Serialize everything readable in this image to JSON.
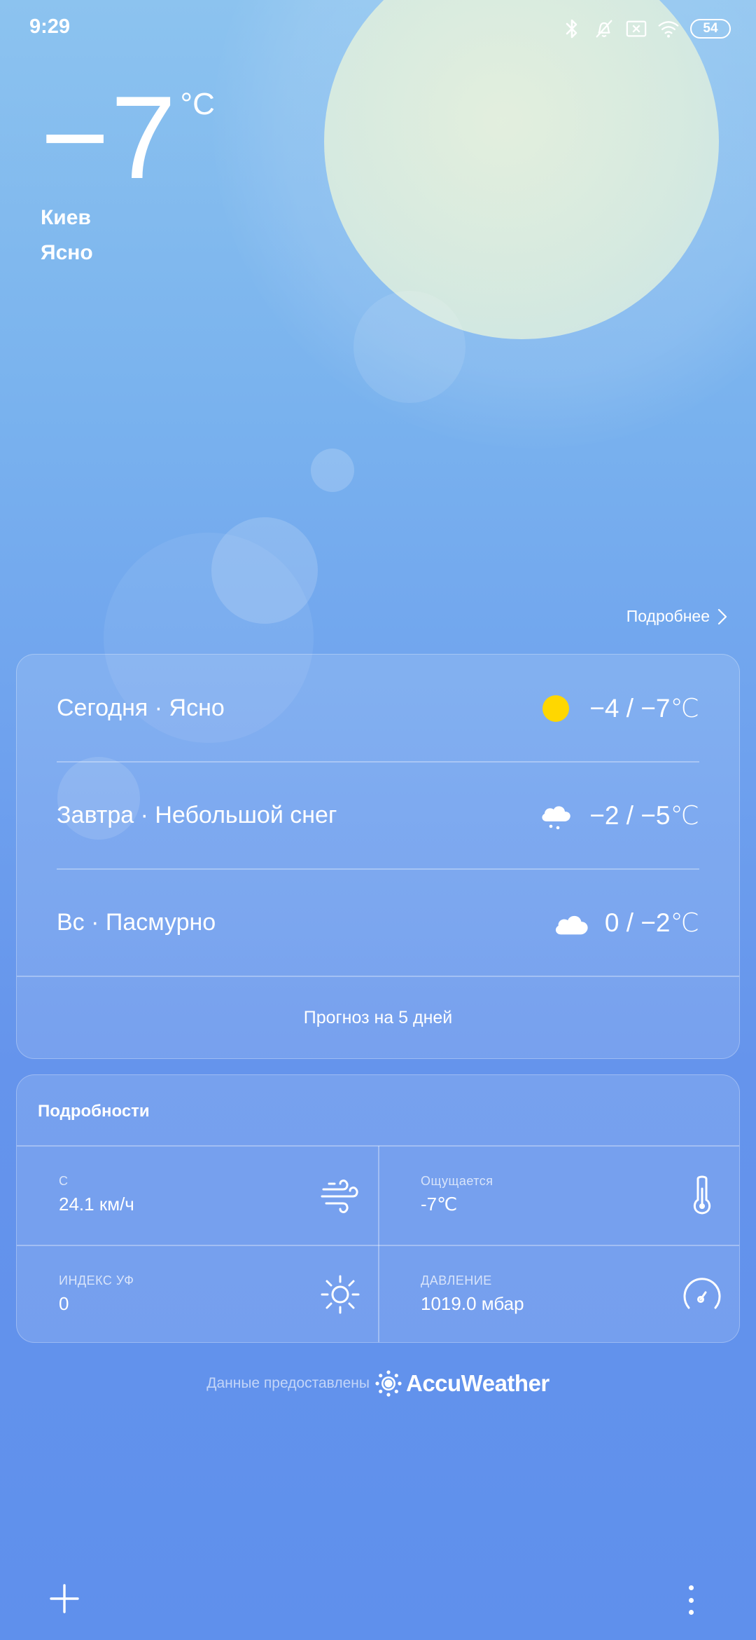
{
  "status_bar": {
    "time": "9:29",
    "battery": "54",
    "icons": [
      "bluetooth-icon",
      "alarm-off-icon",
      "sim-off-icon",
      "wifi-icon",
      "battery-icon"
    ]
  },
  "current": {
    "temperature": "−7",
    "unit": "°C",
    "city": "Киев",
    "condition": "Ясно"
  },
  "more_link": {
    "label": "Подробнее"
  },
  "forecast": {
    "days": [
      {
        "label": "Сегодня · Ясно",
        "temps": "−4 / −7℃",
        "icon": "sun-icon"
      },
      {
        "label": "Завтра · Небольшой снег",
        "temps": "−2 / −5℃",
        "icon": "light-snow-icon"
      },
      {
        "label": "Вс · Пасмурно",
        "temps": "0 / −2℃",
        "icon": "cloud-icon"
      }
    ],
    "five_day_label": "Прогноз на 5 дней"
  },
  "details": {
    "title": "Подробности",
    "cells": [
      {
        "label": "С",
        "value": "24.1 км/ч",
        "icon": "wind-icon"
      },
      {
        "label": "Ощущается",
        "value": "-7℃",
        "icon": "thermometer-icon"
      },
      {
        "label": "ИНДЕКС УФ",
        "value": "0",
        "icon": "uv-sun-icon"
      },
      {
        "label": "ДАВЛЕНИЕ",
        "value": "1019.0 мбар",
        "icon": "pressure-gauge-icon"
      }
    ]
  },
  "attribution": {
    "text": "Данные предоставлены",
    "provider": "AccuWeather"
  },
  "colors": {
    "background_top": "#8cc3ef",
    "background_bottom": "#5f90ec",
    "sun": "#ffd700",
    "text": "#ffffff"
  }
}
